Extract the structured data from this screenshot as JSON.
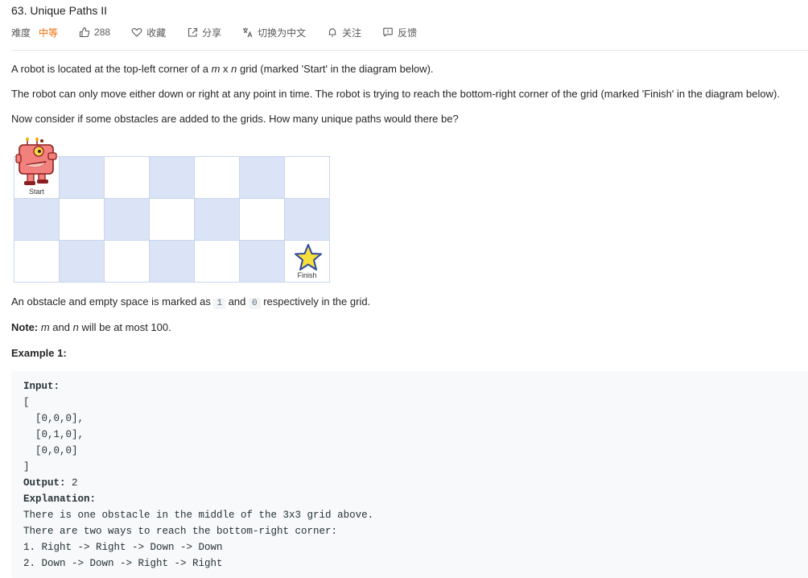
{
  "problem": {
    "title": "63. Unique Paths II"
  },
  "meta": {
    "difficulty_label": "难度",
    "difficulty_value": "中等",
    "likes": "288",
    "favorite": "收藏",
    "share": "分享",
    "switch_lang": "切换为中文",
    "follow": "关注",
    "feedback": "反馈"
  },
  "colors": {
    "difficulty": "#ef6c00",
    "grid_fill": "#dae4f6",
    "grid_border": "#c9d6ee"
  },
  "desc": {
    "p1_a": "A robot is located at the top-left corner of a ",
    "p1_m": "m",
    "p1_x": " x ",
    "p1_n": "n",
    "p1_b": " grid (marked 'Start' in the diagram below).",
    "p2": "The robot can only move either down or right at any point in time. The robot is trying to reach the bottom-right corner of the grid (marked 'Finish' in the diagram below).",
    "p3": "Now consider if some obstacles are added to the grids. How many unique paths would there be?",
    "p4_a": "An obstacle and empty space is marked as ",
    "p4_one": "1",
    "p4_and": " and ",
    "p4_zero": "0",
    "p4_b": " respectively in the grid.",
    "note_label": "Note:",
    "note_m": "m",
    "note_and": " and ",
    "note_n": "n",
    "note_rest": " will be at most 100.",
    "example_heading": "Example 1:"
  },
  "diagram": {
    "start_label": "Start",
    "finish_label": "Finish",
    "rows": 3,
    "cols": 7
  },
  "example": {
    "lines": [
      {
        "text": "Input:",
        "bold": true
      },
      {
        "text": "[",
        "bold": false
      },
      {
        "text": "  [0,0,0],",
        "bold": false
      },
      {
        "text": "  [0,1,0],",
        "bold": false
      },
      {
        "text": "  [0,0,0]",
        "bold": false
      },
      {
        "text": "]",
        "bold": false
      },
      {
        "text": "Output:",
        "bold": true,
        "suffix": " 2"
      },
      {
        "text": "Explanation:",
        "bold": true
      },
      {
        "text": "There is one obstacle in the middle of the 3x3 grid above.",
        "bold": false
      },
      {
        "text": "There are two ways to reach the bottom-right corner:",
        "bold": false
      },
      {
        "text": "1. Right -> Right -> Down -> Down",
        "bold": false
      },
      {
        "text": "2. Down -> Down -> Right -> Right",
        "bold": false
      }
    ]
  }
}
